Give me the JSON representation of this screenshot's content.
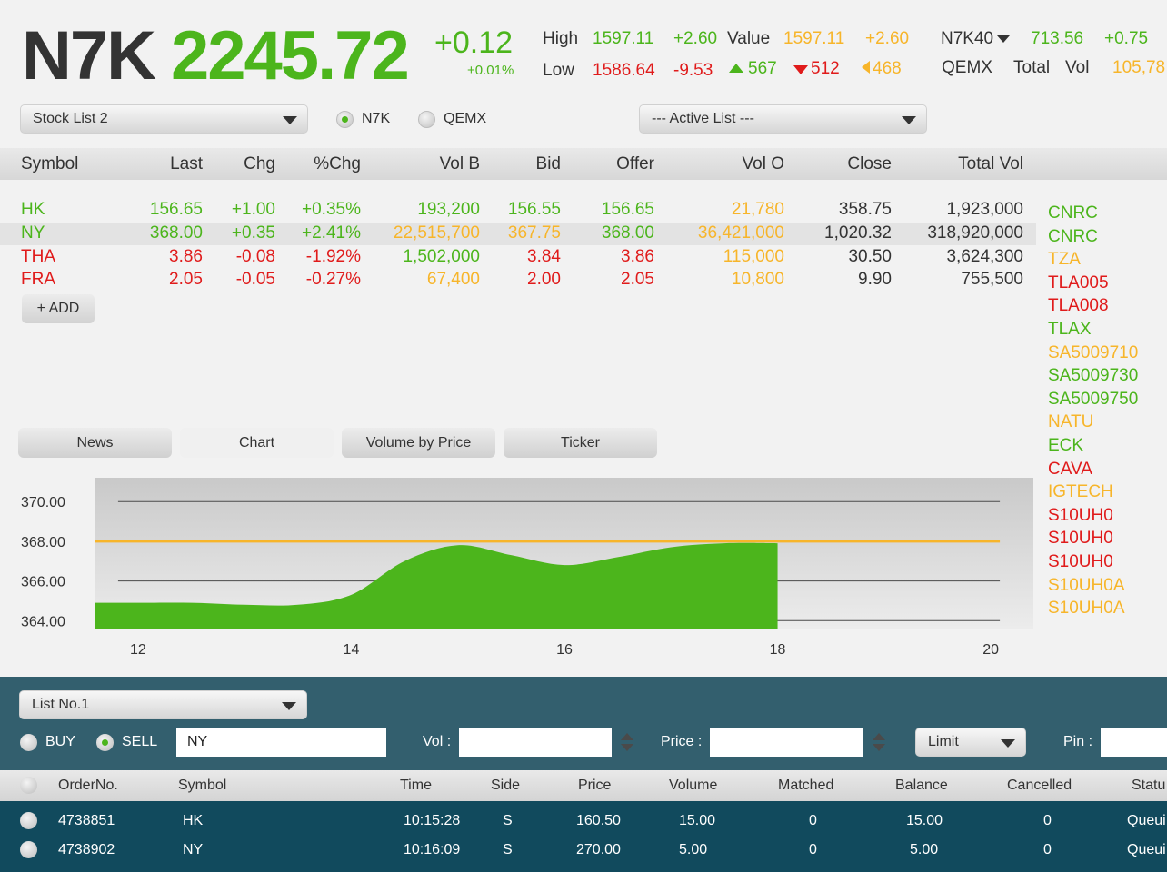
{
  "header": {
    "index_name": "N7K",
    "index_value": "2245.72",
    "index_change": "+0.12",
    "index_pct": "+0.01%",
    "high_label": "High",
    "high_value": "1597.11",
    "high_change": "+2.60",
    "value_label": "Value",
    "value_value": "1597.11",
    "value_change": "+2.60",
    "low_label": "Low",
    "low_value": "1586.64",
    "low_change": "-9.53",
    "up_count": "567",
    "down_count": "512",
    "unchanged_count": "468",
    "sub_index_name": "N7K40",
    "sub_index_value": "713.56",
    "sub_index_change": "+0.75",
    "market_name": "QEMX",
    "total_vol_label": "Total",
    "vol_label": "Vol",
    "total_vol_value": "105,78"
  },
  "controls": {
    "stock_list_select": "Stock List 2",
    "radio_n7k": "N7K",
    "radio_qemx": "QEMX",
    "active_list_select": "--- Active List ---"
  },
  "table": {
    "headers": {
      "symbol": "Symbol",
      "last": "Last",
      "chg": "Chg",
      "pct": "%Chg",
      "volb": "Vol B",
      "bid": "Bid",
      "offer": "Offer",
      "volo": "Vol O",
      "close": "Close",
      "totalvol": "Total Vol"
    },
    "rows": [
      {
        "symbol": "HK",
        "last": "156.65",
        "chg": "+1.00",
        "pct": "+0.35%",
        "volb": "193,200",
        "bid": "156.55",
        "offer": "156.65",
        "volo": "21,780",
        "close": "358.75",
        "totalvol": "1,923,000"
      },
      {
        "symbol": "NY",
        "last": "368.00",
        "chg": "+0.35",
        "pct": "+2.41%",
        "volb": "22,515,700",
        "bid": "367.75",
        "offer": "368.00",
        "volo": "36,421,000",
        "close": "1,020.32",
        "totalvol": "318,920,000"
      },
      {
        "symbol": "THA",
        "last": "3.86",
        "chg": "-0.08",
        "pct": "-1.92%",
        "volb": "1,502,000",
        "bid": "3.84",
        "offer": "3.86",
        "volo": "115,000",
        "close": "30.50",
        "totalvol": "3,624,300"
      },
      {
        "symbol": "FRA",
        "last": "2.05",
        "chg": "-0.05",
        "pct": "-0.27%",
        "volb": "67,400",
        "bid": "2.00",
        "offer": "2.05",
        "volo": "10,800",
        "close": "9.90",
        "totalvol": "755,500"
      }
    ],
    "add_button": "+ ADD"
  },
  "watchlist": [
    {
      "symbol": "CNRC",
      "color": "#4cb51c"
    },
    {
      "symbol": "CNRC",
      "color": "#4cb51c"
    },
    {
      "symbol": "TZA",
      "color": "#f7b52a"
    },
    {
      "symbol": "TLA005",
      "color": "#e01b1b"
    },
    {
      "symbol": "TLA008",
      "color": "#e01b1b"
    },
    {
      "symbol": "TLAX",
      "color": "#4cb51c"
    },
    {
      "symbol": "SA5009710",
      "color": "#f7b52a"
    },
    {
      "symbol": "SA5009730",
      "color": "#4cb51c"
    },
    {
      "symbol": "SA5009750",
      "color": "#4cb51c"
    },
    {
      "symbol": "NATU",
      "color": "#f7b52a"
    },
    {
      "symbol": "ECK",
      "color": "#4cb51c"
    },
    {
      "symbol": "CAVA",
      "color": "#e01b1b"
    },
    {
      "symbol": "IGTECH",
      "color": "#f7b52a"
    },
    {
      "symbol": "S10UH0",
      "color": "#e01b1b"
    },
    {
      "symbol": "S10UH0",
      "color": "#e01b1b"
    },
    {
      "symbol": "S10UH0",
      "color": "#e01b1b"
    },
    {
      "symbol": "S10UH0A",
      "color": "#f7b52a"
    },
    {
      "symbol": "S10UH0A",
      "color": "#f7b52a"
    }
  ],
  "tabs": {
    "news": "News",
    "chart": "Chart",
    "volume_by_price": "Volume by Price",
    "ticker": "Ticker"
  },
  "chart_data": {
    "type": "area",
    "title": "",
    "xlabel": "",
    "ylabel": "",
    "x": [
      12,
      12.5,
      13,
      13.5,
      14,
      14.5,
      15,
      15.5,
      16,
      16.5,
      17,
      17.5,
      18
    ],
    "values": [
      364.9,
      364.9,
      364.8,
      364.8,
      365.3,
      367.0,
      367.8,
      367.3,
      366.8,
      367.2,
      367.7,
      367.9,
      367.9
    ],
    "reference_line": 368.0,
    "reference_color": "#f7b52a",
    "fill_color": "#4cb51c",
    "xlim": [
      11.6,
      20.4
    ],
    "ylim": [
      363.6,
      371.2
    ],
    "x_ticks": [
      12,
      14,
      16,
      18,
      20
    ],
    "y_ticks": [
      "364.00",
      "366.00",
      "368.00",
      "370.00"
    ],
    "gridlines": [
      364,
      366,
      370
    ]
  },
  "order": {
    "list_select": "List No.1",
    "buy_label": "BUY",
    "sell_label": "SELL",
    "symbol_value": "NY",
    "vol_label": "Vol :",
    "price_label": "Price :",
    "order_type": "Limit",
    "pin_label": "Pin :"
  },
  "orders": {
    "headers": {
      "orderno": "OrderNo.",
      "symbol": "Symbol",
      "time": "Time",
      "side": "Side",
      "price": "Price",
      "volume": "Volume",
      "matched": "Matched",
      "balance": "Balance",
      "cancelled": "Cancelled",
      "status": "Statu"
    },
    "rows": [
      {
        "orderno": "4738851",
        "symbol": "HK",
        "time": "10:15:28",
        "side": "S",
        "price": "160.50",
        "volume": "15.00",
        "matched": "0",
        "balance": "15.00",
        "cancelled": "0",
        "status": "Queui"
      },
      {
        "orderno": "4738902",
        "symbol": "NY",
        "time": "10:16:09",
        "side": "S",
        "price": "270.00",
        "volume": "5.00",
        "matched": "0",
        "balance": "5.00",
        "cancelled": "0",
        "status": "Queui"
      }
    ]
  }
}
